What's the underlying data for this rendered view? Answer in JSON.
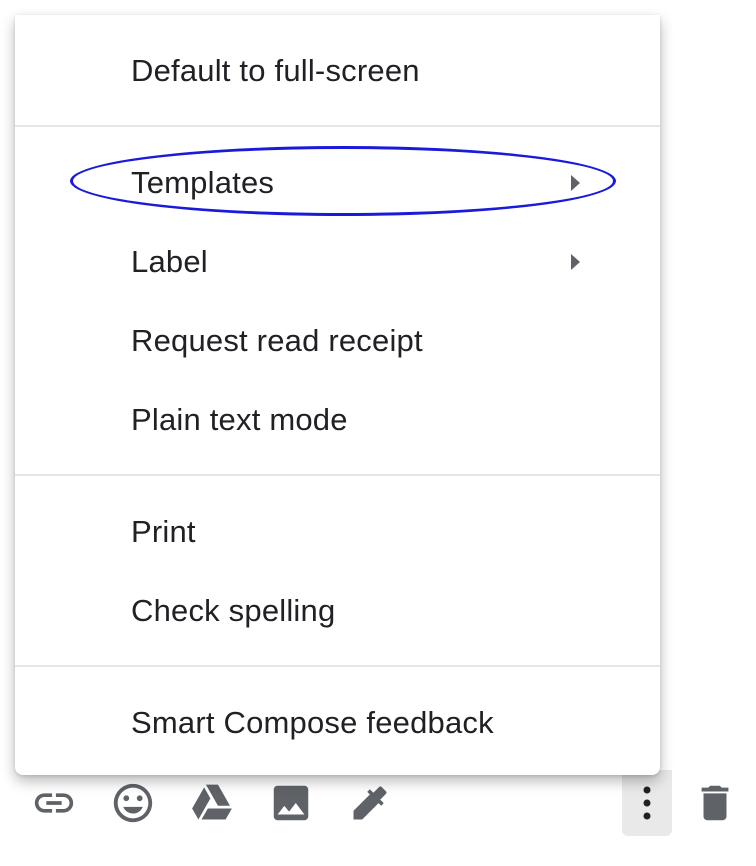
{
  "menu": {
    "items": [
      {
        "label": "Default to full-screen",
        "submenu": false
      },
      {
        "label": "Templates",
        "submenu": true
      },
      {
        "label": "Label",
        "submenu": true
      },
      {
        "label": "Request read receipt",
        "submenu": false
      },
      {
        "label": "Plain text mode",
        "submenu": false
      },
      {
        "label": "Print",
        "submenu": false
      },
      {
        "label": "Check spelling",
        "submenu": false
      },
      {
        "label": "Smart Compose feedback",
        "submenu": false
      }
    ],
    "highlighted_item": "Templates",
    "highlight_color": "#1a1adb"
  },
  "toolbar": {
    "icons": [
      "insert-link-icon",
      "emoji-icon",
      "google-drive-icon",
      "insert-photo-icon",
      "signature-pen-icon",
      "more-options-icon",
      "trash-icon"
    ],
    "icon_color": "#5f6368",
    "active_button_bg": "#e9e9e9"
  }
}
